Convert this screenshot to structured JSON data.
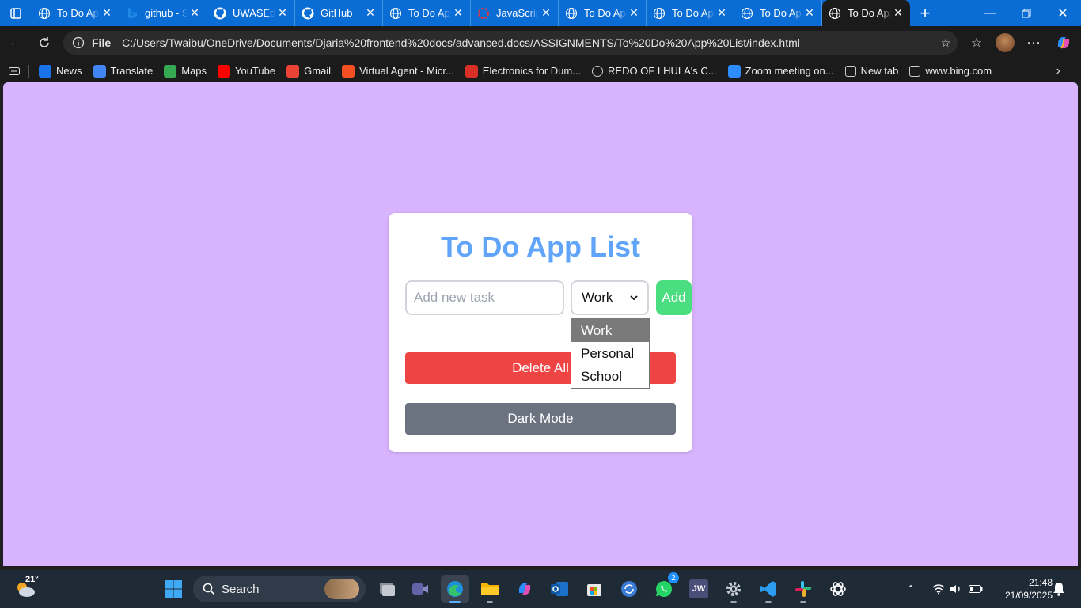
{
  "browser": {
    "tabs": [
      {
        "title": "To Do App List",
        "icon": "globe-icon",
        "active": false
      },
      {
        "title": "github - Search",
        "icon": "bing-icon",
        "active": false
      },
      {
        "title": "UWASEdjaria",
        "icon": "github-icon",
        "active": false
      },
      {
        "title": "GitHub",
        "icon": "github-icon",
        "active": false
      },
      {
        "title": "To Do App List",
        "icon": "globe-icon",
        "active": false
      },
      {
        "title": "JavaScript",
        "icon": "loading-icon",
        "active": false
      },
      {
        "title": "To Do App List",
        "icon": "globe-icon",
        "active": false
      },
      {
        "title": "To Do App List",
        "icon": "globe-icon",
        "active": false
      },
      {
        "title": "To Do App List",
        "icon": "globe-icon",
        "active": false
      },
      {
        "title": "To Do App List",
        "icon": "globe-icon",
        "active": true
      }
    ],
    "address": {
      "scheme_label": "File",
      "url": "C:/Users/Twaibu/OneDrive/Documents/Djaria%20frontend%20docs/advanced.docs/ASSIGNMENTS/To%20Do%20App%20List/index.html"
    },
    "favorites": [
      {
        "label": "News",
        "icon": "news-icon",
        "color": "#1a73e8"
      },
      {
        "label": "Translate",
        "icon": "translate-icon",
        "color": "#4285f4"
      },
      {
        "label": "Maps",
        "icon": "maps-icon",
        "color": "#34a853"
      },
      {
        "label": "YouTube",
        "icon": "youtube-icon",
        "color": "#ff0000"
      },
      {
        "label": "Gmail",
        "icon": "gmail-icon",
        "color": "#ea4335"
      },
      {
        "label": "Virtual Agent - Micr...",
        "icon": "microsoft-icon",
        "color": "#f25022"
      },
      {
        "label": "Electronics for Dum...",
        "icon": "pdf-icon",
        "color": "#d93025"
      },
      {
        "label": "REDO OF LHULA's C...",
        "icon": "globe-icon",
        "color": "#cccccc"
      },
      {
        "label": "Zoom meeting on...",
        "icon": "zoom-icon",
        "color": "#2d8cff"
      },
      {
        "label": "New tab",
        "icon": "newtab-icon",
        "color": "#cccccc"
      },
      {
        "label": "www.bing.com",
        "icon": "search-icon",
        "color": "#cccccc"
      }
    ]
  },
  "app": {
    "title": "To Do App List",
    "task_placeholder": "Add new task",
    "category_selected": "Work",
    "category_options": [
      "Work",
      "Personal",
      "School"
    ],
    "add_label": "Add",
    "delete_all_label": "Delete All",
    "dark_mode_label": "Dark Mode",
    "colors": {
      "page_bg": "#d8b4fe",
      "title": "#60a5fa",
      "add": "#4ade80",
      "delete": "#ef4444",
      "dark_mode": "#6b7280"
    }
  },
  "taskbar": {
    "weather_temp": "21°",
    "search_label": "Search",
    "whatsapp_badge": "2",
    "time": "21:48",
    "date": "21/09/2025"
  }
}
